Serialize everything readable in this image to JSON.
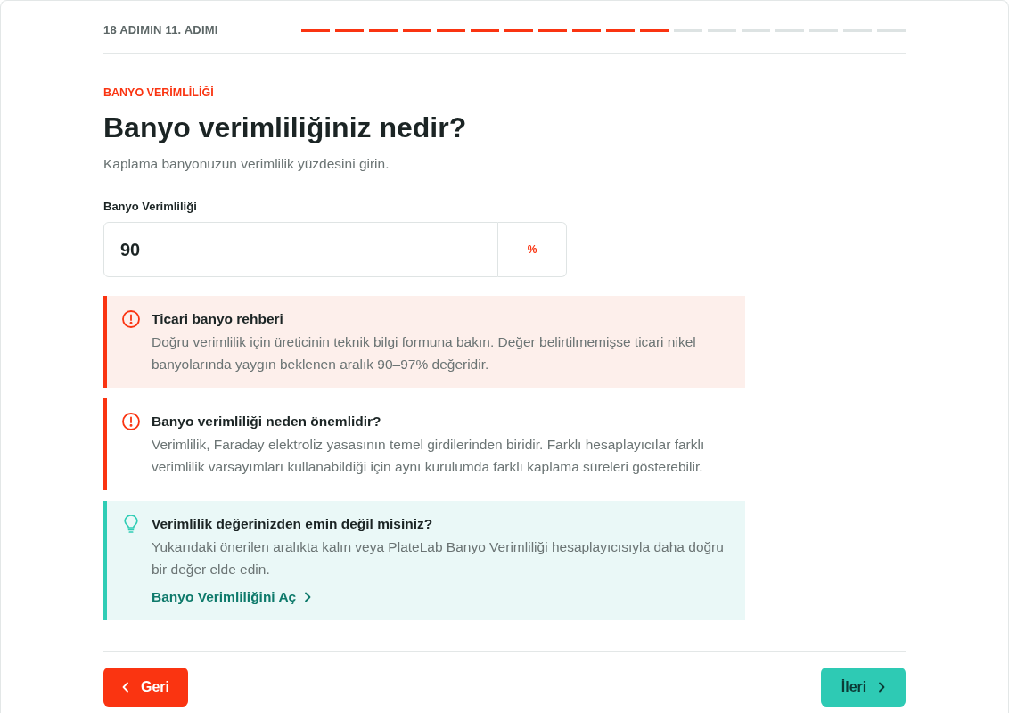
{
  "progress": {
    "step_label": "18 ADIMIN 11. ADIMI",
    "segments": [
      {
        "filled": true
      },
      {
        "filled": true
      },
      {
        "filled": true
      },
      {
        "filled": true
      },
      {
        "filled": true
      },
      {
        "filled": true
      },
      {
        "filled": true
      },
      {
        "filled": true
      },
      {
        "filled": true
      },
      {
        "filled": true
      },
      {
        "filled": true
      },
      {
        "filled": false
      },
      {
        "filled": false
      },
      {
        "filled": false
      },
      {
        "filled": false
      },
      {
        "filled": false
      },
      {
        "filled": false
      },
      {
        "filled": false
      }
    ]
  },
  "question": {
    "category": "BANYO VERİMLİLİĞİ",
    "title": "Banyo verimliliğiniz nedir?",
    "subtitle": "Kaplama banyonuzun verimlilik yüzdesini girin."
  },
  "field": {
    "label": "Banyo Verimliliği",
    "value": "90",
    "unit": "%"
  },
  "callouts": [
    {
      "kind": "warning",
      "highlighted": true,
      "title": "Ticari banyo rehberi",
      "body": "Doğru verimlilik için üreticinin teknik bilgi formuna bakın. Değer belirtilmemişse ticari nikel banyolarında yaygın beklenen aralık 90–97% değeridir."
    },
    {
      "kind": "warning",
      "highlighted": false,
      "title": "Banyo verimliliği neden önemlidir?",
      "body": "Verimlilik, Faraday elektroliz yasasının temel girdilerinden biridir. Farklı hesaplayıcılar farklı verimlilik varsayımları kullanabildiği için aynı kurulumda farklı kaplama süreleri gösterebilir."
    },
    {
      "kind": "tip",
      "highlighted": true,
      "title": "Verimlilik değerinizden emin değil misiniz?",
      "body": "Yukarıdaki önerilen aralıkta kalın veya PlateLab Banyo Verimliliği hesaplayıcısıyla daha doğru bir değer elde edin.",
      "link": "Banyo Verimliliğini Aç"
    }
  ],
  "navigation": [
    {
      "kind": "back",
      "label": "Geri"
    },
    {
      "kind": "next",
      "label": "İleri"
    }
  ]
}
